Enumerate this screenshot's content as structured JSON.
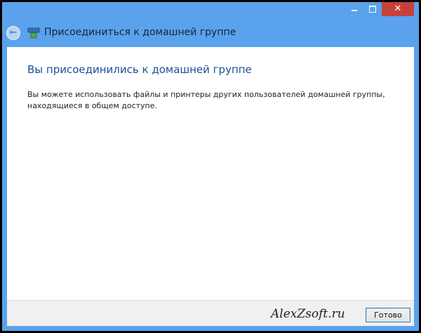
{
  "window": {
    "title": "Присоединиться к домашней группе",
    "close_glyph": "✕",
    "back_glyph": "←",
    "accent_color": "#5aa2ec"
  },
  "content": {
    "heading": "Вы присоединились к домашней группе",
    "description": "Вы можете использовать файлы и принтеры других пользователей домашней группы, находящиеся в общем доступе."
  },
  "footer": {
    "watermark": "AlexZsoft.ru",
    "done_label": "Готово"
  },
  "icons": {
    "back": "back-arrow-icon",
    "homegroup": "homegroup-icon",
    "minimize": "minimize-icon",
    "maximize": "maximize-icon",
    "close": "close-icon"
  }
}
